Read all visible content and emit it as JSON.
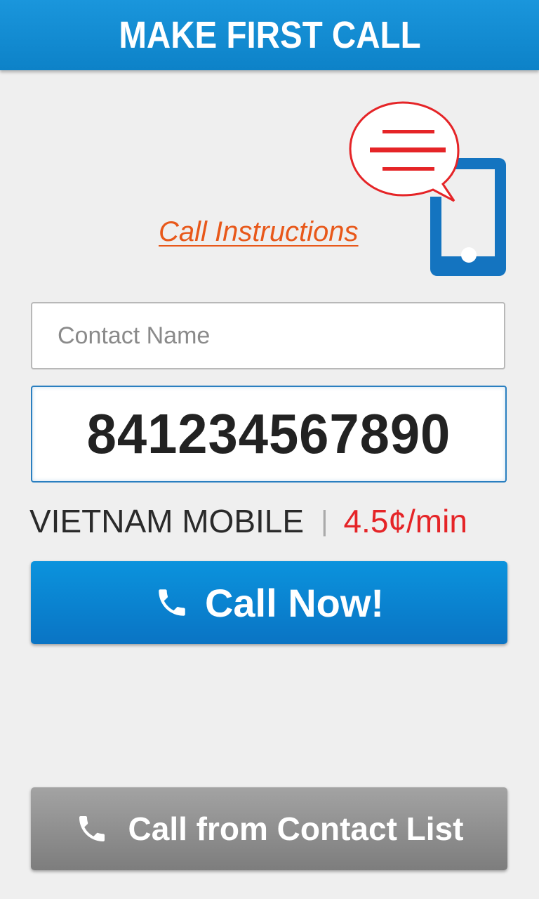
{
  "header": {
    "title": "MAKE FIRST CALL"
  },
  "instructions": {
    "label": "Call Instructions"
  },
  "contact_name": {
    "placeholder": "Contact Name",
    "value": ""
  },
  "phone": {
    "number": "841234567890"
  },
  "rate_info": {
    "carrier": "VIETNAM MOBILE",
    "separator": "|",
    "rate": "4.5¢/min"
  },
  "buttons": {
    "call_now": "Call Now!",
    "call_from_contacts": "Call from Contact List"
  },
  "icons": {
    "illustration": "phone-chat-bubble-icon",
    "call_now_icon": "phone-handset-icon",
    "contacts_icon": "phone-handset-icon"
  },
  "colors": {
    "header": "#1a96dc",
    "accent_blue": "#0a7fc8",
    "link_orange": "#e8581a",
    "rate_red": "#e52427",
    "gray_button": "#8f8f8f"
  }
}
